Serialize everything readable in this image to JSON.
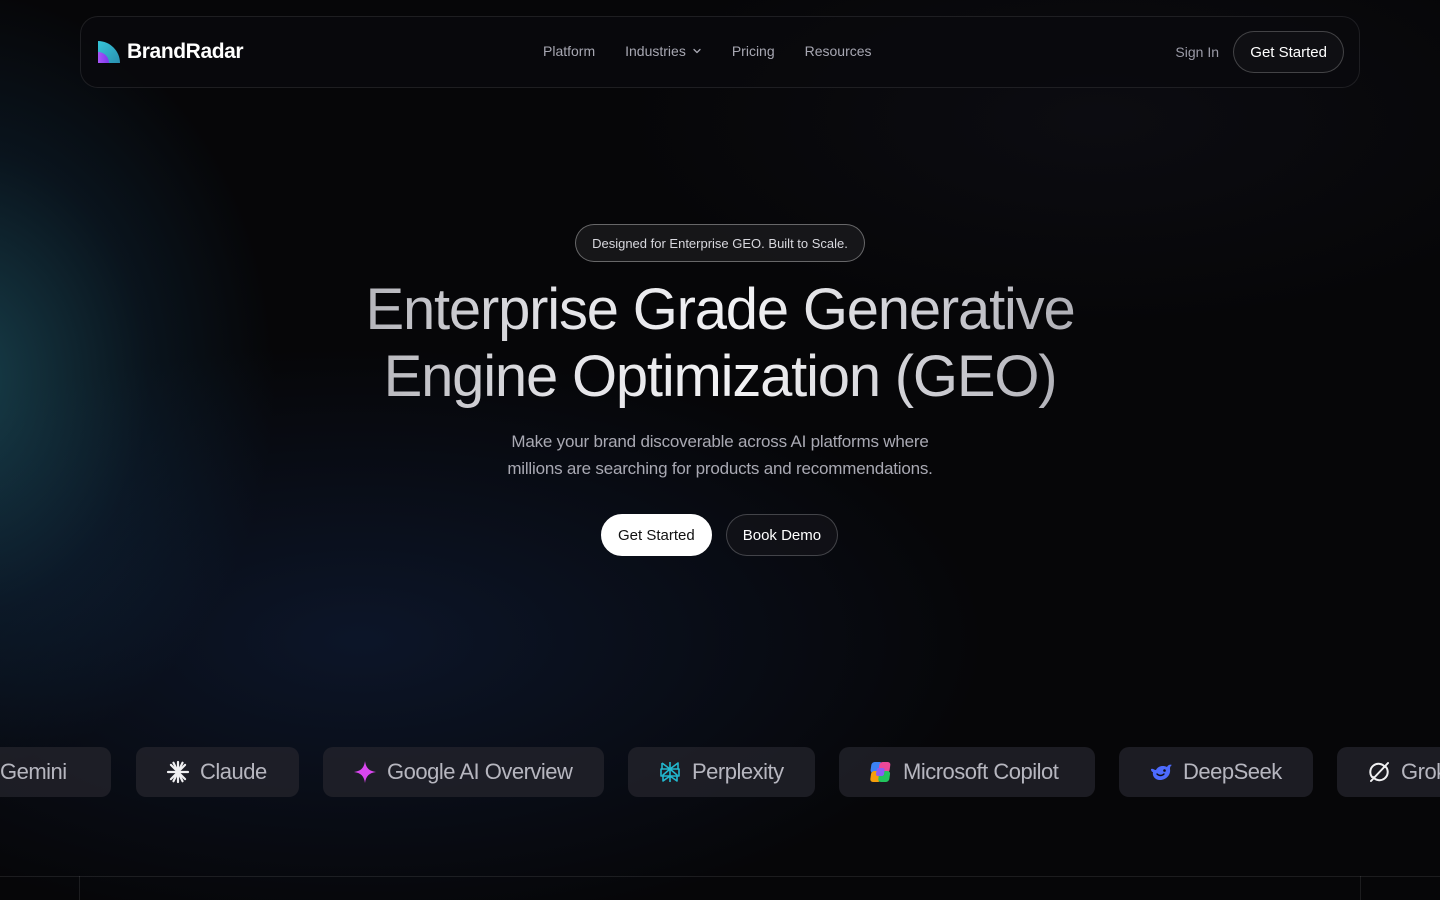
{
  "brand": {
    "name": "BrandRadar"
  },
  "nav": {
    "links": [
      {
        "label": "Platform"
      },
      {
        "label": "Industries"
      },
      {
        "label": "Pricing"
      },
      {
        "label": "Resources"
      }
    ],
    "sign_in": "Sign In",
    "cta": "Get Started"
  },
  "hero": {
    "badge": "Designed for Enterprise GEO. Built to Scale.",
    "title_line1": "Enterprise Grade Generative",
    "title_line2": "Engine Optimization (GEO)",
    "subtitle_line1": "Make your brand discoverable across AI platforms where",
    "subtitle_line2": "millions are searching for products and recommendations.",
    "primary_button": "Get Started",
    "secondary_button": "Book Demo"
  },
  "platforms": [
    {
      "label": "Gemini",
      "icon": "gemini-icon"
    },
    {
      "label": "Claude",
      "icon": "claude-icon"
    },
    {
      "label": "Google AI Overview",
      "icon": "google-sparkle-icon"
    },
    {
      "label": "Perplexity",
      "icon": "perplexity-icon"
    },
    {
      "label": "Microsoft Copilot",
      "icon": "copilot-icon"
    },
    {
      "label": "DeepSeek",
      "icon": "deepseek-icon"
    },
    {
      "label": "Grok",
      "icon": "grok-icon"
    }
  ],
  "colors": {
    "background": "#060608",
    "accent_teal": "#2a7f8f",
    "sparkle_magenta": "#d946ef",
    "deepseek_blue": "#4d6bfe"
  }
}
